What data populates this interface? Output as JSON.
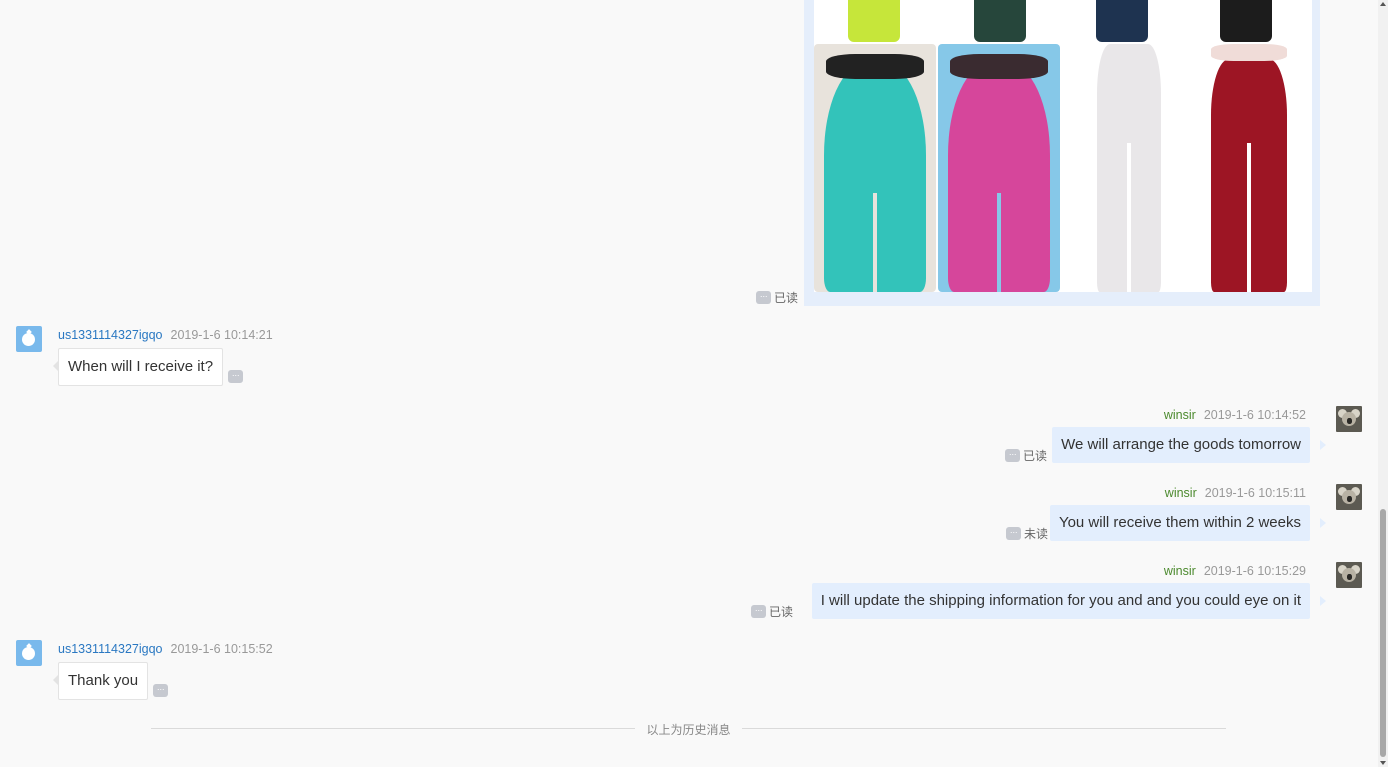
{
  "image_message": {
    "read_status": "已读",
    "options_icon": "more-dots-icon",
    "colors": {
      "legging_lime": "#c6e63a",
      "legging_darkgreen": "#26463b",
      "legging_navy": "#1e3350",
      "legging_black": "#1c1c1c",
      "teal": "#33c3ba",
      "pink": "#d6469b",
      "white": "#e9e7e9",
      "red": "#9d1524",
      "bg_blue": "#86c8e8"
    }
  },
  "messages": [
    {
      "side": "left",
      "sender": "us1331114327igqo",
      "time": "2019-1-6 10:14:21",
      "text": "When will I receive it?"
    },
    {
      "side": "right",
      "sender": "winsir",
      "time": "2019-1-6 10:14:52",
      "text": "We will arrange the goods tomorrow",
      "read_status": "已读"
    },
    {
      "side": "right",
      "sender": "winsir",
      "time": "2019-1-6 10:15:11",
      "text": "You will receive them within 2 weeks",
      "read_status": "未读"
    },
    {
      "side": "right",
      "sender": "winsir",
      "time": "2019-1-6 10:15:29",
      "text": "I will update the shipping information for you and and you could eye on it",
      "read_status": "已读"
    },
    {
      "side": "left",
      "sender": "us1331114327igqo",
      "time": "2019-1-6 10:15:52",
      "text": "Thank you"
    }
  ],
  "history_divider": "以上为历史消息",
  "icons": {
    "customer_avatar": "drop-avatar-icon",
    "staff_avatar": "koala-avatar-icon",
    "options": "more-dots-icon"
  }
}
